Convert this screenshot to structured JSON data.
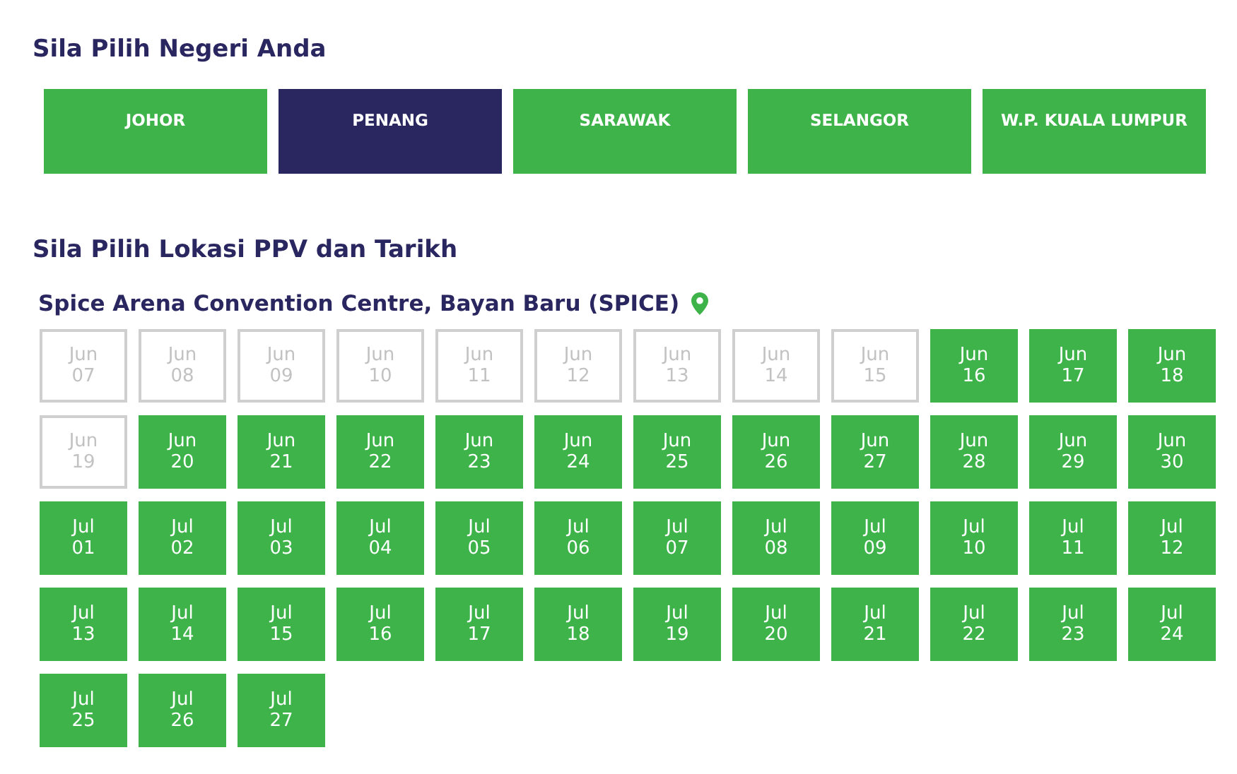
{
  "state_heading": "Sila Pilih Negeri Anda",
  "states": [
    {
      "label": "JOHOR",
      "selected": false
    },
    {
      "label": "PENANG",
      "selected": true
    },
    {
      "label": "SARAWAK",
      "selected": false
    },
    {
      "label": "SELANGOR",
      "selected": false
    },
    {
      "label": "W.P. KUALA LUMPUR",
      "selected": false
    }
  ],
  "location_heading": "Sila Pilih Lokasi PPV dan Tarikh",
  "location": {
    "name": "Spice Arena Convention Centre, Bayan Baru (SPICE)"
  },
  "dates": [
    {
      "label": "Jun 07",
      "disabled": true
    },
    {
      "label": "Jun 08",
      "disabled": true
    },
    {
      "label": "Jun 09",
      "disabled": true
    },
    {
      "label": "Jun 10",
      "disabled": true
    },
    {
      "label": "Jun 11",
      "disabled": true
    },
    {
      "label": "Jun 12",
      "disabled": true
    },
    {
      "label": "Jun 13",
      "disabled": true
    },
    {
      "label": "Jun 14",
      "disabled": true
    },
    {
      "label": "Jun 15",
      "disabled": true
    },
    {
      "label": "Jun 16",
      "disabled": false
    },
    {
      "label": "Jun 17",
      "disabled": false
    },
    {
      "label": "Jun 18",
      "disabled": false
    },
    {
      "label": "Jun 19",
      "disabled": true
    },
    {
      "label": "Jun 20",
      "disabled": false
    },
    {
      "label": "Jun 21",
      "disabled": false
    },
    {
      "label": "Jun 22",
      "disabled": false
    },
    {
      "label": "Jun 23",
      "disabled": false
    },
    {
      "label": "Jun 24",
      "disabled": false
    },
    {
      "label": "Jun 25",
      "disabled": false
    },
    {
      "label": "Jun 26",
      "disabled": false
    },
    {
      "label": "Jun 27",
      "disabled": false
    },
    {
      "label": "Jun 28",
      "disabled": false
    },
    {
      "label": "Jun 29",
      "disabled": false
    },
    {
      "label": "Jun 30",
      "disabled": false
    },
    {
      "label": "Jul 01",
      "disabled": false
    },
    {
      "label": "Jul 02",
      "disabled": false
    },
    {
      "label": "Jul 03",
      "disabled": false
    },
    {
      "label": "Jul 04",
      "disabled": false
    },
    {
      "label": "Jul 05",
      "disabled": false
    },
    {
      "label": "Jul 06",
      "disabled": false
    },
    {
      "label": "Jul 07",
      "disabled": false
    },
    {
      "label": "Jul 08",
      "disabled": false
    },
    {
      "label": "Jul 09",
      "disabled": false
    },
    {
      "label": "Jul 10",
      "disabled": false
    },
    {
      "label": "Jul 11",
      "disabled": false
    },
    {
      "label": "Jul 12",
      "disabled": false
    },
    {
      "label": "Jul 13",
      "disabled": false
    },
    {
      "label": "Jul 14",
      "disabled": false
    },
    {
      "label": "Jul 15",
      "disabled": false
    },
    {
      "label": "Jul 16",
      "disabled": false
    },
    {
      "label": "Jul 17",
      "disabled": false
    },
    {
      "label": "Jul 18",
      "disabled": false
    },
    {
      "label": "Jul 19",
      "disabled": false
    },
    {
      "label": "Jul 20",
      "disabled": false
    },
    {
      "label": "Jul 21",
      "disabled": false
    },
    {
      "label": "Jul 22",
      "disabled": false
    },
    {
      "label": "Jul 23",
      "disabled": false
    },
    {
      "label": "Jul 24",
      "disabled": false
    },
    {
      "label": "Jul 25",
      "disabled": false
    },
    {
      "label": "Jul 26",
      "disabled": false
    },
    {
      "label": "Jul 27",
      "disabled": false
    }
  ]
}
